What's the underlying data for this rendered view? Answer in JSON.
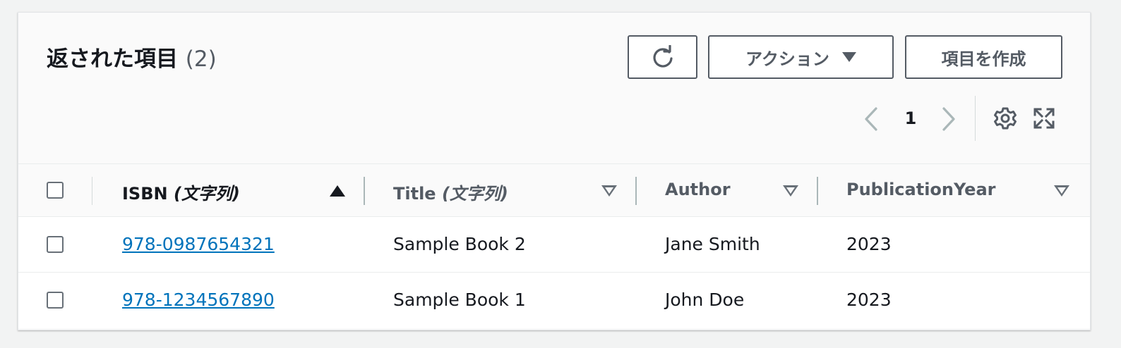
{
  "header": {
    "title": "返された項目",
    "count": "(2)"
  },
  "toolbar": {
    "refresh_icon": "refresh-icon",
    "actions_label": "アクション",
    "create_label": "項目を作成"
  },
  "pagination": {
    "current_page": "1",
    "prev_icon": "chevron-left-icon",
    "next_icon": "chevron-right-icon"
  },
  "tools": {
    "settings_icon": "gear-icon",
    "fullscreen_icon": "fullscreen-icon"
  },
  "table": {
    "columns": [
      {
        "name": "ISBN",
        "type": "(文字列)",
        "sort": "ascending"
      },
      {
        "name": "Title",
        "type": "(文字列)",
        "sort": "none"
      },
      {
        "name": "Author",
        "type": "",
        "sort": "none"
      },
      {
        "name": "PublicationYear",
        "type": "",
        "sort": "none"
      }
    ],
    "rows": [
      {
        "isbn": "978-0987654321",
        "title": "Sample Book 2",
        "author": "Jane Smith",
        "year": "2023"
      },
      {
        "isbn": "978-1234567890",
        "title": "Sample Book 1",
        "author": "John Doe",
        "year": "2023"
      }
    ]
  },
  "colors": {
    "link": "#0073bb",
    "text": "#16191f",
    "muted": "#545b64"
  }
}
